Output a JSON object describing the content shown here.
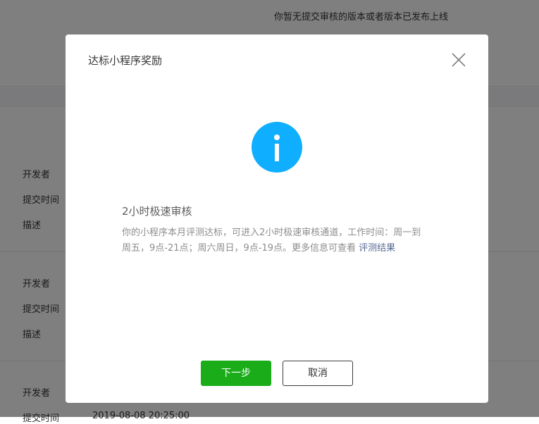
{
  "background": {
    "top_notice": "你暂无提交审核的版本或者版本已发布上线",
    "labels": {
      "developer": "开发者",
      "submit_time": "提交时间",
      "description": "描述"
    },
    "partial_submit_time": "2019-08-08 20:25:00"
  },
  "dialog": {
    "title": "达标小程序奖励",
    "icon": "info-icon",
    "icon_color": "#10aeff",
    "message_title": "2小时极速审核",
    "message_body": "你的小程序本月评测达标，可进入2小时极速审核通道，工作时间：周一到周五，9点-21点；周六周日，9点-19点。更多信息可查看 ",
    "message_link": "评测结果",
    "next_button": "下一步",
    "cancel_button": "取消"
  },
  "colors": {
    "primary": "#1aad19",
    "link": "#576b95",
    "mask": "rgba(0,0,0,0.5)"
  }
}
